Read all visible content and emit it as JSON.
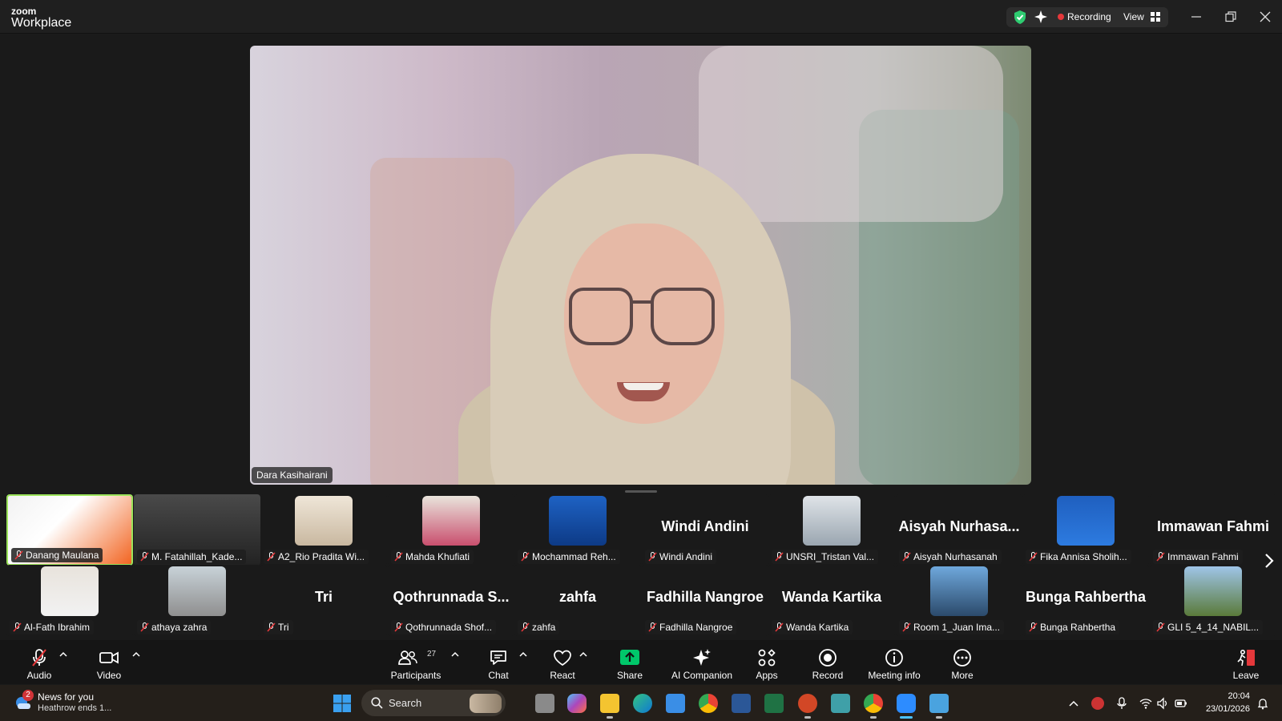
{
  "app": {
    "brand_top": "zoom",
    "brand_bottom": "Workplace"
  },
  "header": {
    "recording_label": "Recording",
    "view_label": "View"
  },
  "speaker": {
    "name": "Dara Kasihairani"
  },
  "gallery": {
    "row1": [
      {
        "label": "Danang Maulana",
        "big": ""
      },
      {
        "label": "M. Fatahillah_Kade...",
        "big": ""
      },
      {
        "label": "A2_Rio Pradita Wi...",
        "big": ""
      },
      {
        "label": "Mahda Khufiati",
        "big": ""
      },
      {
        "label": "Mochammad Reh...",
        "big": ""
      },
      {
        "label": "Windi Andini",
        "big": "Windi Andini"
      },
      {
        "label": "UNSRI_Tristan Val...",
        "big": ""
      },
      {
        "label": "Aisyah Nurhasanah",
        "big": "Aisyah  Nurhasa..."
      },
      {
        "label": "Fika Annisa Sholih...",
        "big": ""
      },
      {
        "label": "Immawan Fahmi",
        "big": "Immawan Fahmi"
      }
    ],
    "row2": [
      {
        "label": "Al-Fath Ibrahim",
        "big": ""
      },
      {
        "label": "athaya zahra",
        "big": ""
      },
      {
        "label": "Tri",
        "big": "Tri"
      },
      {
        "label": "Qothrunnada Shof...",
        "big": "Qothrunnada  S..."
      },
      {
        "label": "zahfa",
        "big": "zahfa"
      },
      {
        "label": "Fadhilla Nangroe",
        "big": "Fadhilla Nangroe"
      },
      {
        "label": "Wanda Kartika",
        "big": "Wanda Kartika"
      },
      {
        "label": "Room 1_Juan Ima...",
        "big": ""
      },
      {
        "label": "Bunga Rahbertha",
        "big": "Bunga Rahbertha"
      },
      {
        "label": "GLI 5_4_14_NABIL...",
        "big": ""
      }
    ]
  },
  "toolbar": {
    "audio": "Audio",
    "video": "Video",
    "participants": "Participants",
    "participant_count": "27",
    "chat": "Chat",
    "react": "React",
    "share": "Share",
    "ai_companion": "AI Companion",
    "apps": "Apps",
    "record": "Record",
    "meeting_info": "Meeting info",
    "more": "More",
    "leave": "Leave"
  },
  "taskbar": {
    "news_badge": "2",
    "news_title": "News for you",
    "news_sub": "Heathrow ends 1...",
    "search_placeholder": "Search",
    "time": "20:04",
    "date": "23/01/2026"
  },
  "colors": {
    "accent_green": "#9be35a",
    "record_red": "#e5383b",
    "share_green": "#00c76a"
  }
}
